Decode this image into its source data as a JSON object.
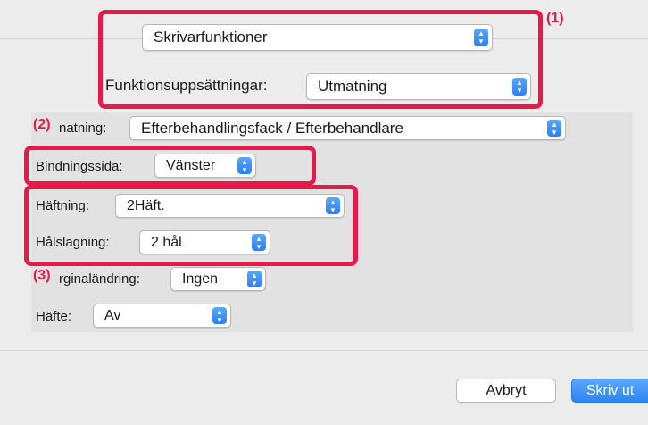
{
  "top": {
    "preset_select": {
      "value": "Skrivarfunktioner"
    },
    "feature_sets_label": "Funktionsuppsättningar:",
    "feature_sets_select": {
      "value": "Utmatning"
    }
  },
  "options": {
    "output_label": "natning:",
    "output_select": {
      "value": "Efterbehandlingsfack / Efterbehandlare"
    },
    "binding_label": "Bindningssida:",
    "binding_select": {
      "value": "Vänster"
    },
    "stapling_label": "Häftning:",
    "stapling_select": {
      "value": "2Häft."
    },
    "punch_label": "Hålslagning:",
    "punch_select": {
      "value": "2 hål"
    },
    "margin_label": "rginaländring:",
    "margin_select": {
      "value": "Ingen"
    },
    "booklet_label": "Häfte:",
    "booklet_select": {
      "value": "Av"
    }
  },
  "callouts": {
    "c1": "(1)",
    "c2": "(2)",
    "c3": "(3)"
  },
  "footer": {
    "cancel_label": "Avbryt",
    "print_label": "Skriv ut"
  },
  "colors": {
    "callout": "#e5194a",
    "accent": "#2f84f2"
  }
}
